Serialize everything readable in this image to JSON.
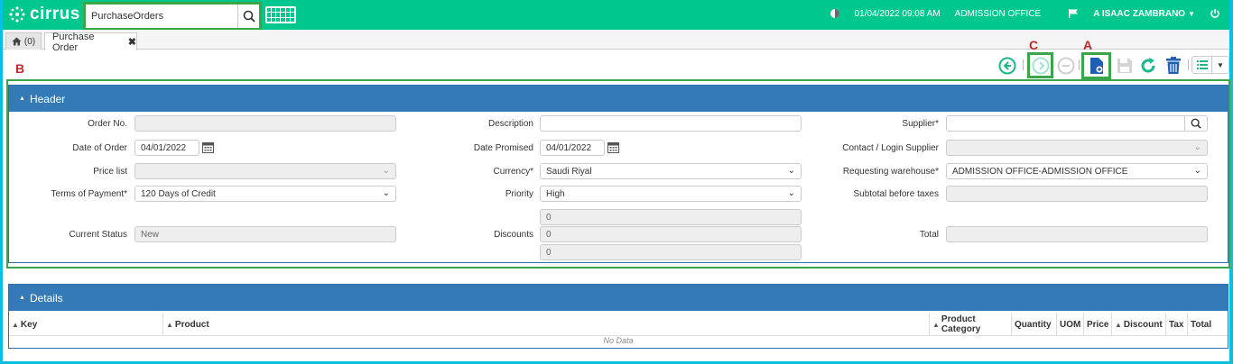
{
  "app": {
    "brand": "cirrus"
  },
  "search": {
    "value": "PurchaseOrders"
  },
  "topbar": {
    "datetime": "01/04/2022 09:08 AM",
    "office": "ADMISSION OFFICE",
    "user": "A ISAAC ZAMBRANO"
  },
  "tabs": {
    "home_count": "(0)",
    "active": "Purchase Order"
  },
  "annotations": {
    "a": "A",
    "b": "B",
    "c": "C"
  },
  "header_panel": {
    "title": "Header",
    "order_no": {
      "label": "Order No.",
      "value": ""
    },
    "date_of_order": {
      "label": "Date of Order",
      "value": "04/01/2022"
    },
    "price_list": {
      "label": "Price list",
      "value": ""
    },
    "terms": {
      "label": "Terms of Payment*",
      "value": "120 Days of Credit"
    },
    "current_status": {
      "label": "Current Status",
      "value": "New"
    },
    "description": {
      "label": "Description",
      "value": ""
    },
    "date_promised": {
      "label": "Date Promised",
      "value": "04/01/2022"
    },
    "currency": {
      "label": "Currency*",
      "value": "Saudi Riyal"
    },
    "priority": {
      "label": "Priority",
      "value": "High"
    },
    "discounts": {
      "label": "Discounts",
      "values": [
        "0",
        "0",
        "0"
      ]
    },
    "supplier": {
      "label": "Supplier*",
      "value": ""
    },
    "contact": {
      "label": "Contact / Login Supplier",
      "value": ""
    },
    "warehouse": {
      "label": "Requesting warehouse*",
      "value": "ADMISSION OFFICE-ADMISSION OFFICE"
    },
    "subtotal": {
      "label": "Subtotal before taxes",
      "value": ""
    },
    "total": {
      "label": "Total",
      "value": ""
    }
  },
  "details_panel": {
    "title": "Details",
    "columns": [
      "Key",
      "Product",
      "Product Category",
      "Quantity",
      "UOM",
      "Price",
      "Discount",
      "Tax",
      "Total"
    ],
    "empty": "No Data"
  },
  "colors": {
    "topbar": "#00c78d",
    "panel_head": "#337ab7",
    "highlight": "#3aa649",
    "annotation": "#c0282d"
  }
}
